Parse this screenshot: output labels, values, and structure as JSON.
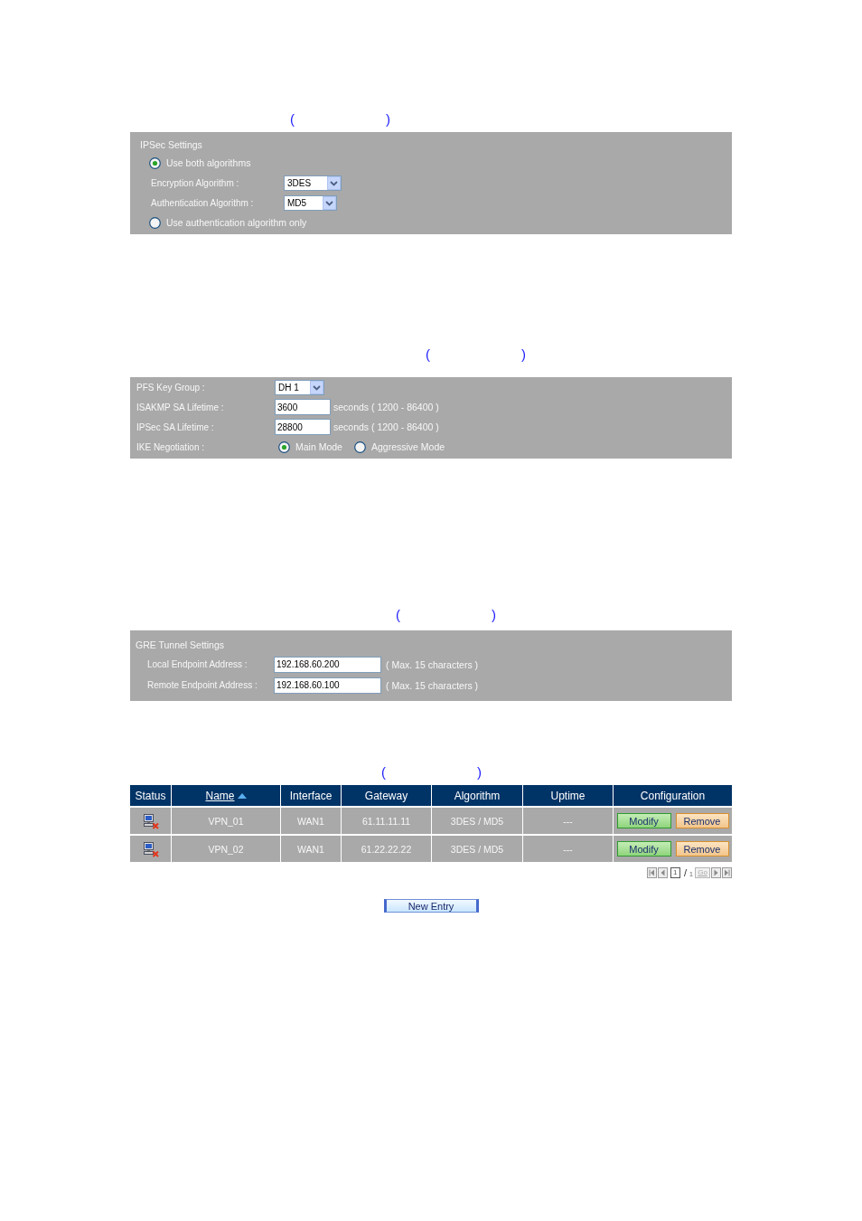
{
  "panels": [
    {
      "caption": {
        "open": "(",
        "close": ")"
      },
      "title": "IPSec Settings",
      "rows": [
        {
          "kind": "radio",
          "label": "Use both algorithms",
          "selected": true
        },
        {
          "kind": "select",
          "label": "Encryption Algorithm :",
          "value": "3DES"
        },
        {
          "kind": "select",
          "label": "Authentication Algorithm :",
          "value": "MD5"
        },
        {
          "kind": "radio",
          "label": "Use authentication algorithm only",
          "selected": false
        }
      ]
    },
    {
      "caption": {
        "open": "(",
        "close": ")"
      },
      "rows": [
        {
          "kind": "select",
          "label": "PFS Key Group :",
          "value": "DH 1"
        },
        {
          "kind": "input",
          "label": "ISAKMP SA Lifetime :",
          "value": "3600",
          "note": "seconds ( 1200 - 86400 )"
        },
        {
          "kind": "input",
          "label": "IPSec SA Lifetime :",
          "value": "28800",
          "note": "seconds ( 1200 - 86400 )"
        },
        {
          "kind": "radio_group",
          "label": "IKE Negotiation :",
          "options": [
            {
              "label": "Main Mode",
              "selected": true
            },
            {
              "label": "Aggressive Mode",
              "selected": false
            }
          ]
        }
      ]
    },
    {
      "caption": {
        "open": "(",
        "close": ")"
      },
      "title": "GRE Tunnel Settings",
      "rows": [
        {
          "kind": "input",
          "label": "Local Endpoint Address :",
          "value": "192.168.60.200",
          "note": "( Max. 15 characters )"
        },
        {
          "kind": "input",
          "label": "Remote Endpoint Address :",
          "value": "192.168.60.100",
          "note": "( Max. 15 characters )"
        }
      ]
    }
  ],
  "tunnel_list": {
    "caption": {
      "open": "(",
      "close": ")"
    },
    "columns": [
      {
        "label": "Status",
        "sorted": false
      },
      {
        "label": "Name",
        "sorted": true
      },
      {
        "label": "Interface",
        "sorted": false
      },
      {
        "label": "Gateway",
        "sorted": false
      },
      {
        "label": "Algorithm",
        "sorted": false
      },
      {
        "label": "Uptime",
        "sorted": false
      },
      {
        "label": "Configuration",
        "sorted": false
      }
    ],
    "rows": [
      {
        "cells": [
          {
            "kind": "status",
            "connected": false
          },
          {
            "kind": "text",
            "text": "VPN_01"
          },
          {
            "kind": "text",
            "text": "WAN1"
          },
          {
            "kind": "text",
            "text": "61.11.11.11"
          },
          {
            "kind": "text",
            "text": "3DES / MD5"
          },
          {
            "kind": "text",
            "text": "---"
          },
          {
            "kind": "actions",
            "buttons": [
              {
                "kind": "modify",
                "label": "Modify"
              },
              {
                "kind": "remove",
                "label": "Remove"
              }
            ]
          }
        ]
      },
      {
        "cells": [
          {
            "kind": "status",
            "connected": false
          },
          {
            "kind": "text",
            "text": "VPN_02"
          },
          {
            "kind": "text",
            "text": "WAN1"
          },
          {
            "kind": "text",
            "text": "61.22.22.22"
          },
          {
            "kind": "text",
            "text": "3DES / MD5"
          },
          {
            "kind": "text",
            "text": "---"
          },
          {
            "kind": "actions",
            "buttons": [
              {
                "kind": "modify",
                "label": "Modify"
              },
              {
                "kind": "remove",
                "label": "Remove"
              }
            ]
          }
        ]
      }
    ],
    "pagination": {
      "page": "1",
      "separator": "/",
      "total": "1",
      "go": "Go"
    },
    "new_entry": "New Entry"
  }
}
